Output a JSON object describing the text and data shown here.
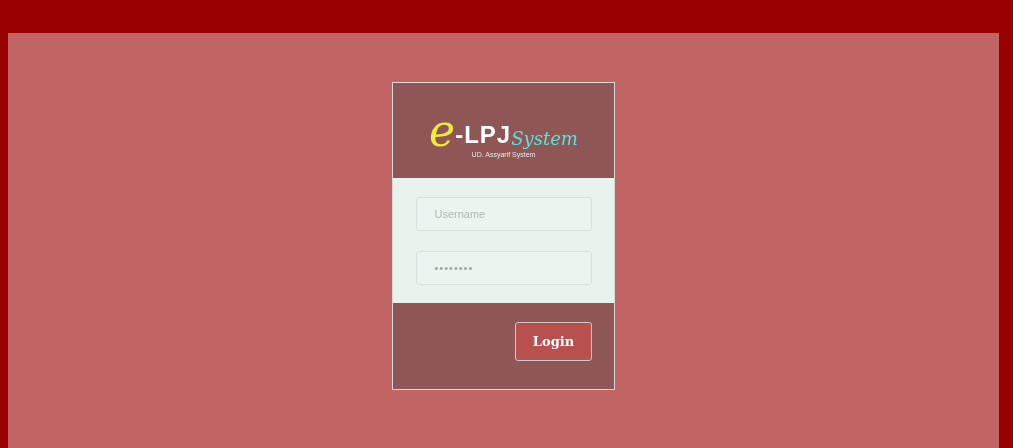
{
  "logo": {
    "letter": "e",
    "name": "-LPJ",
    "suffix": "System",
    "subtitle": "UD. Assyarif System"
  },
  "form": {
    "username": {
      "placeholder": "Username"
    },
    "password": {
      "value": "••••••••"
    },
    "submit": "Login"
  }
}
